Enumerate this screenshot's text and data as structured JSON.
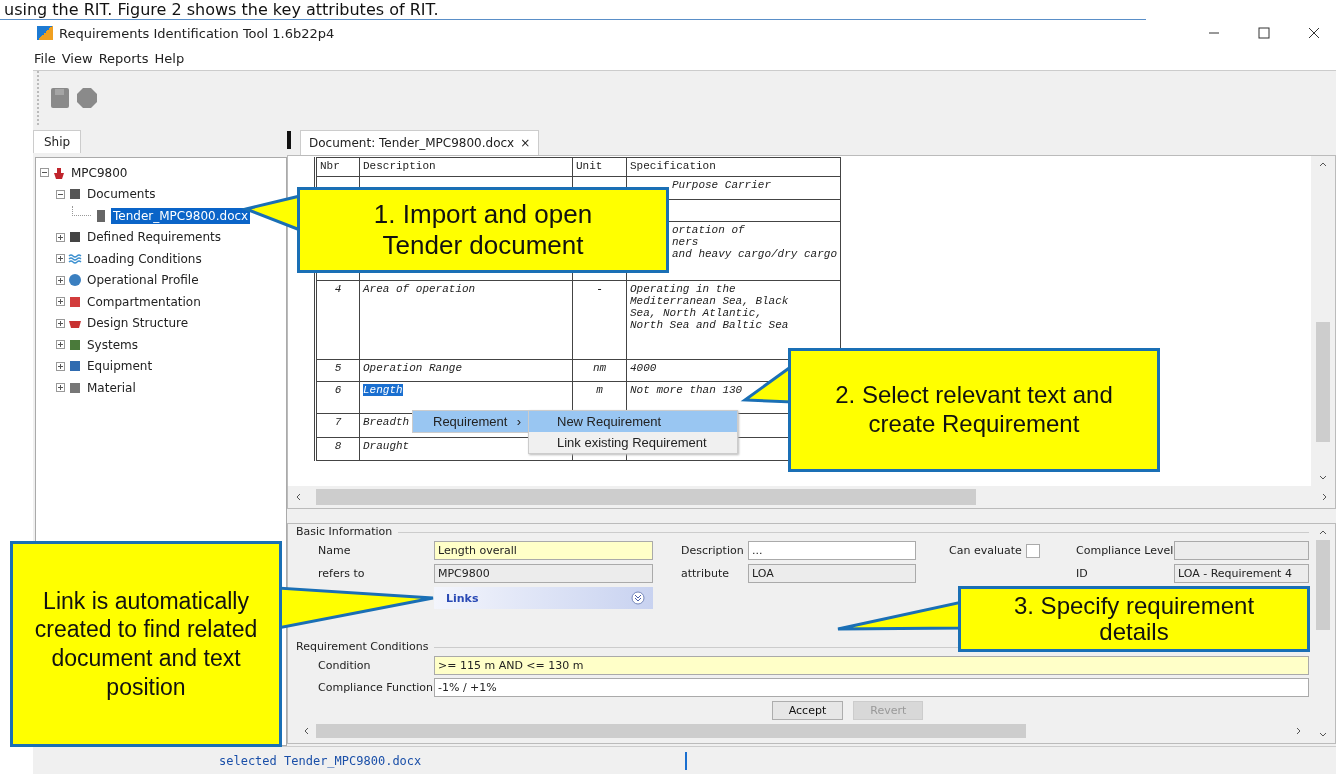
{
  "caption": "using the RIT. Figure 2 shows the key attributes of RIT.",
  "window": {
    "title": "Requirements Identification Tool 1.6b22p4"
  },
  "menu": [
    "File",
    "View",
    "Reports",
    "Help"
  ],
  "side_tab": {
    "label": "Ship",
    "selected": true
  },
  "tree": [
    {
      "label": "MPC9800",
      "kind": "ship",
      "expanded": true,
      "selected": false,
      "children": [
        {
          "label": "Documents",
          "kind": "docs",
          "expanded": true,
          "selected": false,
          "children": [
            {
              "label": "Tender_MPC9800.docx",
              "kind": "file",
              "selected": true
            }
          ]
        },
        {
          "label": "Defined Requirements",
          "kind": "reqs",
          "expanded": false,
          "selected": false
        },
        {
          "label": "Loading Conditions",
          "kind": "waves",
          "expanded": false,
          "selected": false
        },
        {
          "label": "Operational Profile",
          "kind": "globe",
          "expanded": false,
          "selected": false
        },
        {
          "label": "Compartmentation",
          "kind": "compart",
          "expanded": false,
          "selected": false
        },
        {
          "label": "Design Structure",
          "kind": "hull",
          "expanded": false,
          "selected": false
        },
        {
          "label": "Systems",
          "kind": "systems",
          "expanded": false,
          "selected": false
        },
        {
          "label": "Equipment",
          "kind": "equipment",
          "expanded": false,
          "selected": false
        },
        {
          "label": "Material",
          "kind": "material",
          "expanded": false,
          "selected": false
        }
      ]
    }
  ],
  "document_tab": {
    "label": "Document: Tender_MPC9800.docx",
    "close": "×"
  },
  "table": {
    "columns": [
      "Nbr",
      "Description",
      "Unit",
      "Specification"
    ],
    "rows": [
      {
        "kind": "covered",
        "spec": [
          "Purpose Carrier"
        ]
      },
      {
        "kind": "covered",
        "spec": []
      },
      {
        "kind": "covered",
        "spec": [
          "ortation of",
          "ners",
          "and heavy cargo/dry cargo"
        ]
      },
      {
        "kind": "row",
        "nbr": "4",
        "description": "Area of operation",
        "unit": "-",
        "spec": [
          "Operating in the",
          "Mediterranean Sea, Black",
          "Sea, North Atlantic,",
          "North Sea and Baltic Sea"
        ],
        "selected": false
      },
      {
        "kind": "row",
        "nbr": "5",
        "description": "Operation Range",
        "unit": "nm",
        "spec": [
          "4000"
        ],
        "selected": false
      },
      {
        "kind": "row",
        "nbr": "6",
        "description": "Length",
        "unit": "m",
        "spec": [
          "Not more than 130"
        ],
        "selected": true
      },
      {
        "kind": "row",
        "nbr": "7",
        "description": "Breadth",
        "unit": "",
        "spec": [],
        "selected": false
      },
      {
        "kind": "row",
        "nbr": "8",
        "description": "Draught",
        "unit": "",
        "spec": [],
        "selected": false
      }
    ]
  },
  "context_menu": {
    "items": [
      {
        "label": "Requirement",
        "arrow": "›",
        "selected": true
      }
    ],
    "submenu": [
      {
        "label": "New Requirement",
        "selected": true
      },
      {
        "label": "Link existing Requirement",
        "selected": false
      }
    ]
  },
  "basic_information": {
    "title": "Basic Information",
    "name": {
      "label": "Name",
      "value": "Length overall",
      "kind": "required"
    },
    "description": {
      "label": "Description",
      "value": "...",
      "kind": "text"
    },
    "can_evaluate": {
      "label": "Can evaluate",
      "checked": false
    },
    "compliance_level": {
      "label": "Compliance Level",
      "kind": "readonly"
    },
    "refers_to": {
      "label": "refers to",
      "value": "MPC9800",
      "kind": "readonly"
    },
    "attribute": {
      "label": "attribute",
      "value": "LOA",
      "kind": "readonly"
    },
    "id": {
      "label": "ID",
      "value": "LOA - Requirement 4",
      "kind": "readonly"
    },
    "links": {
      "label": "Links",
      "expanded": false
    }
  },
  "requirement_conditions": {
    "title": "Requirement Conditions",
    "condition": {
      "label": "Condition",
      "value": ">= 115 m AND <= 130 m",
      "kind": "required"
    },
    "compliance_function": {
      "label": "Compliance Function",
      "value": "-1% / +1%",
      "kind": "text"
    }
  },
  "buttons": [
    {
      "label": "Accept",
      "disabled": false
    },
    {
      "label": "Revert",
      "disabled": true
    }
  ],
  "status_bar": "selected Tender_MPC9800.docx",
  "callouts": [
    {
      "text": "1. Import and open Tender document"
    },
    {
      "text": "2. Select relevant text and create Requirement"
    },
    {
      "text": "Link is automatically created to find related document and text position"
    },
    {
      "text": "3. Specify requirement details"
    }
  ]
}
